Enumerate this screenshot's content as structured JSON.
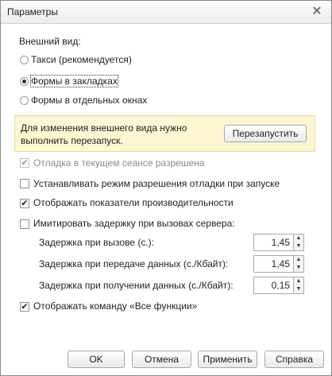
{
  "window": {
    "title": "Параметры",
    "close_symbol": "✕"
  },
  "appearance": {
    "heading": "Внешний вид:",
    "options": [
      {
        "label": "Такси (рекомендуется)",
        "selected": false
      },
      {
        "label": "Формы в закладках",
        "selected": true
      },
      {
        "label": "Формы в отдельных окнах",
        "selected": false
      }
    ]
  },
  "notice": {
    "line1": "Для изменения внешнего вида нужно",
    "line2": "выполнить перезапуск.",
    "restart_button": "Перезапустить"
  },
  "checkboxes": {
    "debug_session": {
      "label": "Отладка в текущем сеансе разрешена",
      "checked": true,
      "enabled": false
    },
    "debug_on_start": {
      "label": "Устанавливать режим разрешения отладки при запуске",
      "checked": false
    },
    "show_performance": {
      "label": "Отображать показатели производительности",
      "checked": true
    },
    "simulate_delay": {
      "label": "Имитировать задержку при вызовах сервера:",
      "checked": false
    },
    "show_all_functions": {
      "label": "Отображать команду «Все функции»",
      "checked": true
    }
  },
  "delays": [
    {
      "label": "Задержка при вызове (с.):",
      "value": "1,45"
    },
    {
      "label": "Задержка при передаче данных (с./Кбайт):",
      "value": "1,45"
    },
    {
      "label": "Задержка при получении данных (с./Кбайт):",
      "value": "0,15"
    }
  ],
  "spin_up": "▲",
  "spin_down": "▼",
  "check_mark": "✔",
  "buttons": {
    "ok": "OK",
    "cancel": "Отмена",
    "apply": "Применить",
    "help": "Справка"
  }
}
